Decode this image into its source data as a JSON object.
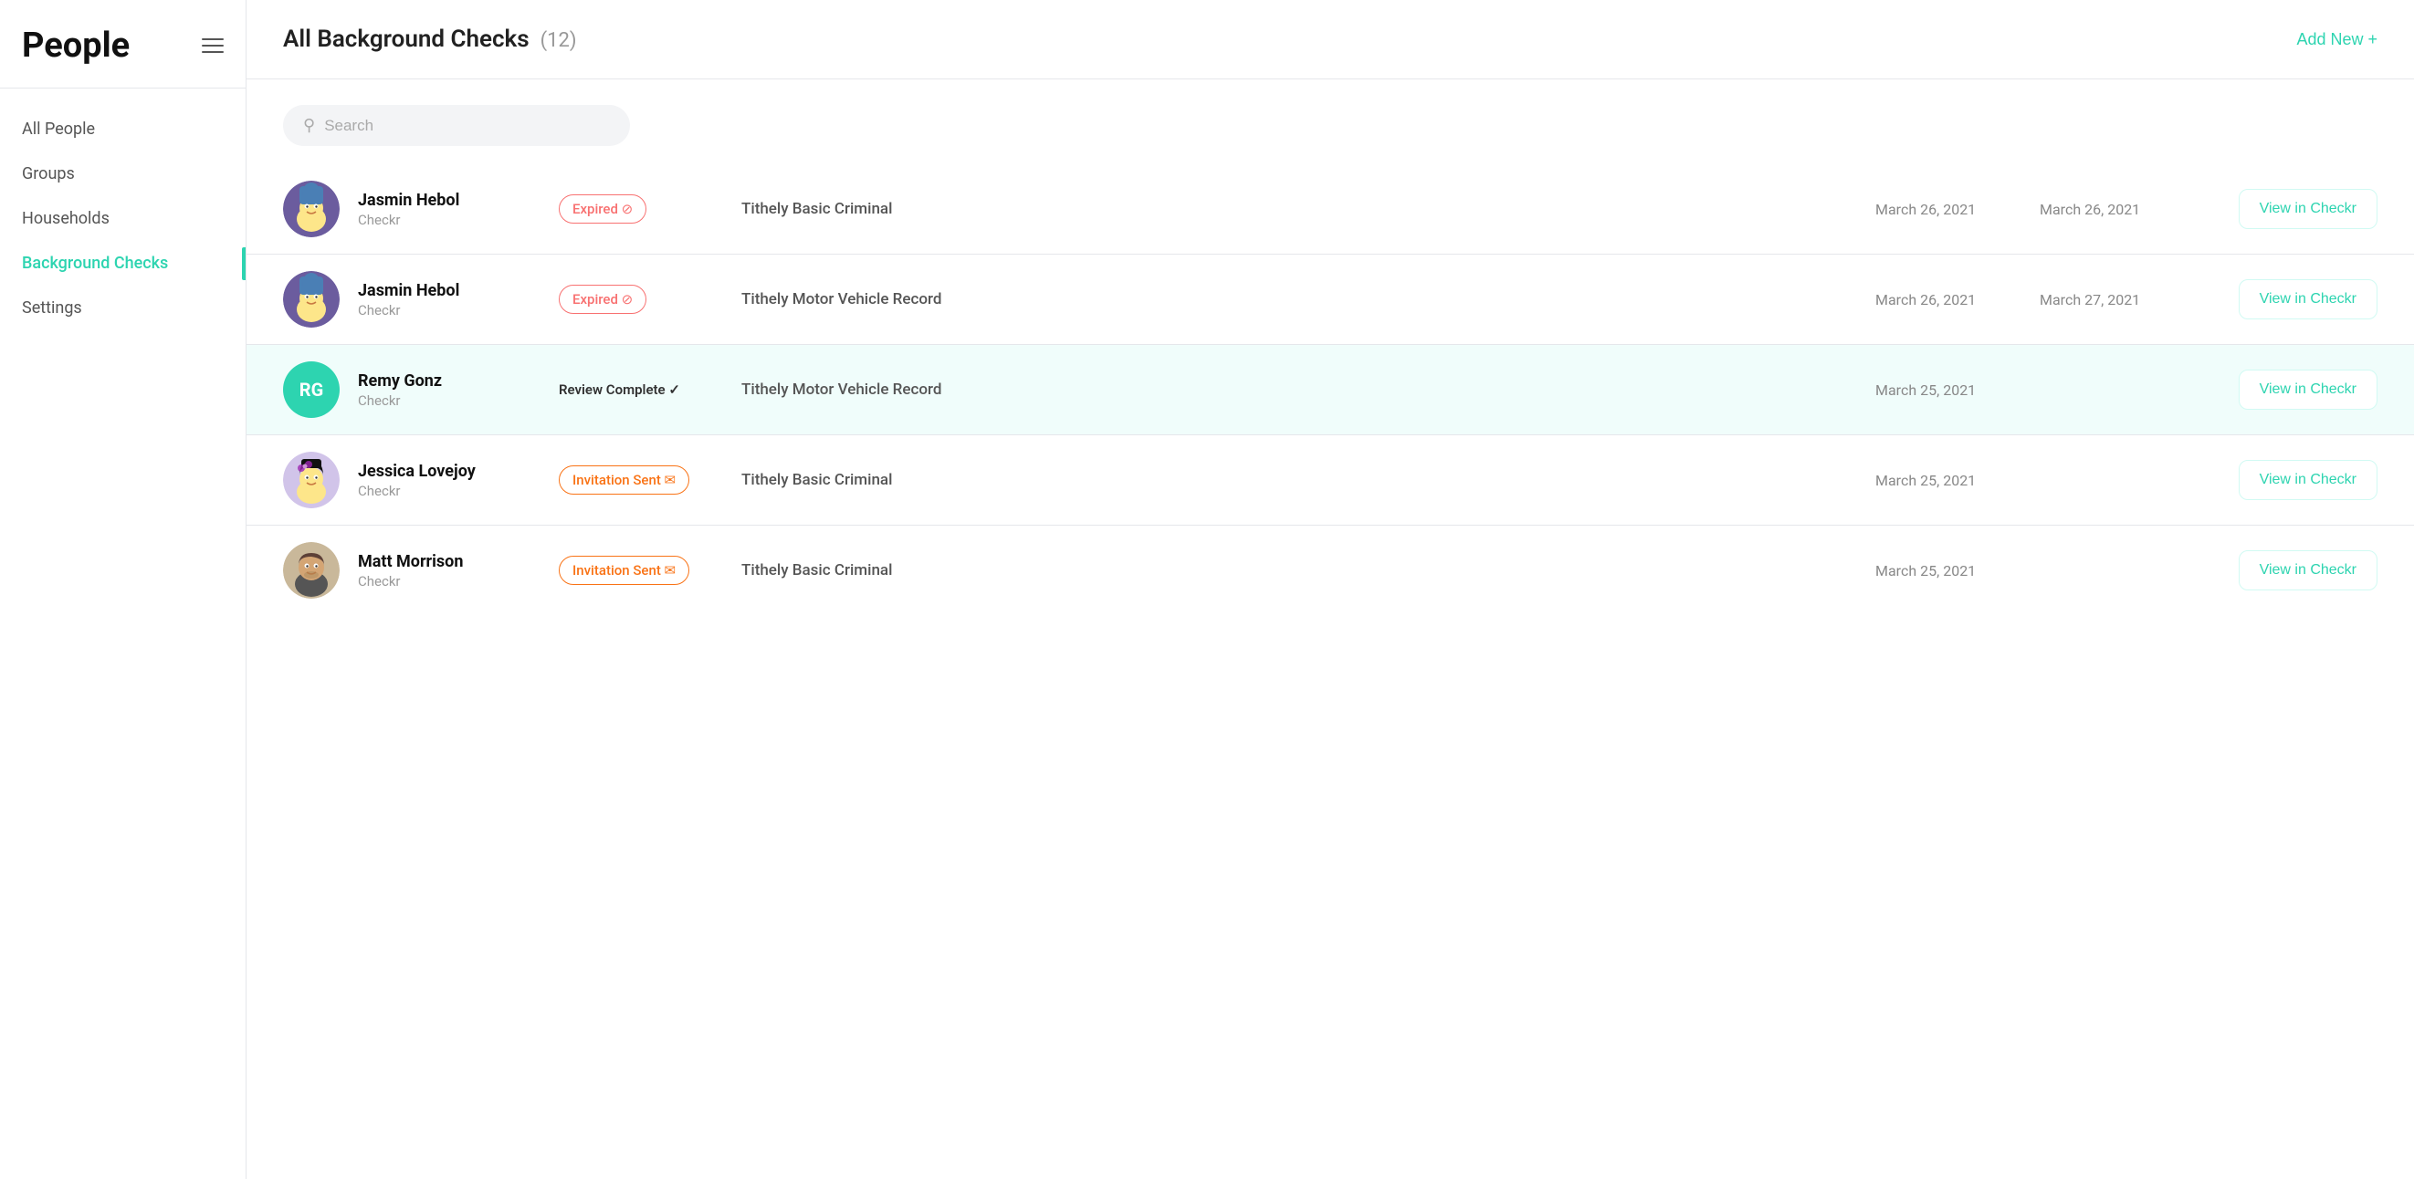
{
  "sidebar": {
    "title": "People",
    "hamburger_label": "menu",
    "nav_items": [
      {
        "id": "all-people",
        "label": "All People",
        "active": false
      },
      {
        "id": "groups",
        "label": "Groups",
        "active": false
      },
      {
        "id": "households",
        "label": "Households",
        "active": false
      },
      {
        "id": "background-checks",
        "label": "Background Checks",
        "active": true
      },
      {
        "id": "settings",
        "label": "Settings",
        "active": false
      }
    ]
  },
  "header": {
    "title": "All Background Checks",
    "count": "(12)",
    "add_new_label": "Add New +"
  },
  "search": {
    "placeholder": "Search"
  },
  "records": [
    {
      "id": 1,
      "name": "Jasmin Hebol",
      "sub": "Checkr",
      "avatar_type": "image",
      "avatar_emoji": "🧟",
      "avatar_color": "#6b5c9e",
      "status": "Expired",
      "status_type": "expired",
      "check_type": "Tithely Basic Criminal",
      "date1": "March 26, 2021",
      "date2": "March 26, 2021",
      "view_label": "View in Checkr",
      "highlighted": false
    },
    {
      "id": 2,
      "name": "Jasmin Hebol",
      "sub": "Checkr",
      "avatar_type": "image",
      "avatar_emoji": "🧟",
      "avatar_color": "#6b5c9e",
      "status": "Expired",
      "status_type": "expired",
      "check_type": "Tithely Motor Vehicle Record",
      "date1": "March 26, 2021",
      "date2": "March 27, 2021",
      "view_label": "View in Checkr",
      "highlighted": false
    },
    {
      "id": 3,
      "name": "Remy Gonz",
      "sub": "Checkr",
      "avatar_type": "initials",
      "initials": "RG",
      "avatar_color": "#2dd4b0",
      "status": "Review Complete ✓",
      "status_type": "review",
      "check_type": "Tithely Motor Vehicle Record",
      "date1": "March 25, 2021",
      "date2": "",
      "view_label": "View in Checkr",
      "highlighted": true
    },
    {
      "id": 4,
      "name": "Jessica Lovejoy",
      "sub": "Checkr",
      "avatar_type": "image",
      "avatar_emoji": "🦸",
      "avatar_color": "#333",
      "status": "Invitation Sent ✉",
      "status_type": "invitation",
      "check_type": "Tithely Basic Criminal",
      "date1": "March 25, 2021",
      "date2": "",
      "view_label": "View in Checkr",
      "highlighted": false
    },
    {
      "id": 5,
      "name": "Matt Morrison",
      "sub": "Checkr",
      "avatar_type": "photo",
      "avatar_color": "#555",
      "status": "Invitation Sent ✉",
      "status_type": "invitation",
      "check_type": "Tithely Basic Criminal",
      "date1": "March 25, 2021",
      "date2": "",
      "view_label": "View in Checkr",
      "highlighted": false
    }
  ]
}
